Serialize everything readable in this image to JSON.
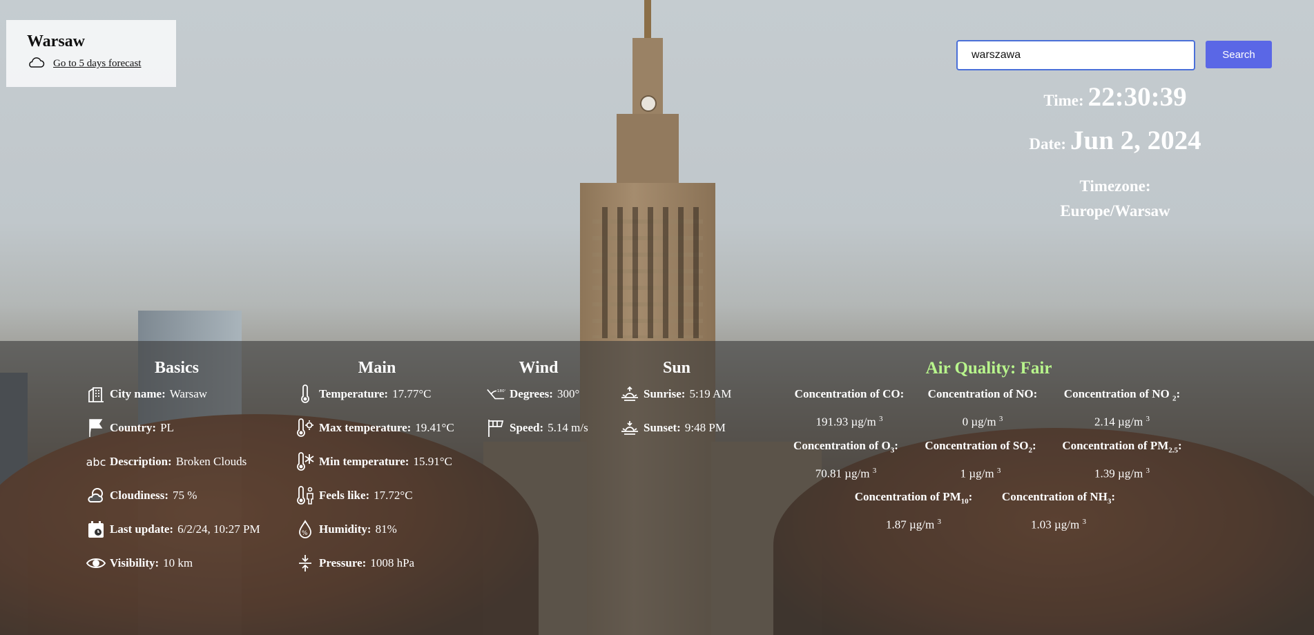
{
  "city_card": {
    "name": "Warsaw",
    "forecast_link": "Go to 5 days forecast"
  },
  "search": {
    "value": "warszawa",
    "button": "Search"
  },
  "clock": {
    "time_label": "Time:",
    "time": "22:30:39",
    "date_label": "Date:",
    "date": "Jun 2, 2024",
    "tz_label": "Timezone:",
    "tz": "Europe/Warsaw"
  },
  "basics": {
    "title": "Basics",
    "items": [
      {
        "icon": "city-icon",
        "label": "City name:",
        "value": "Warsaw"
      },
      {
        "icon": "flag-icon",
        "label": "Country:",
        "value": "PL"
      },
      {
        "icon": "text-abc-icon",
        "label": "Description:",
        "value": "Broken Clouds"
      },
      {
        "icon": "cloudiness-icon",
        "label": "Cloudiness:",
        "value": "75 %"
      },
      {
        "icon": "calendar-clock-icon",
        "label": "Last update:",
        "value": "6/2/24, 10:27 PM"
      },
      {
        "icon": "eye-icon",
        "label": "Visibility:",
        "value": "10 km"
      }
    ]
  },
  "main": {
    "title": "Main",
    "items": [
      {
        "icon": "thermometer-icon",
        "label": "Temperature:",
        "value": "17.77°C"
      },
      {
        "icon": "thermometer-hot-icon",
        "label": "Max temperature:",
        "value": "19.41°C"
      },
      {
        "icon": "thermometer-cold-icon",
        "label": "Min temperature:",
        "value": "15.91°C"
      },
      {
        "icon": "feels-like-icon",
        "label": "Feels like:",
        "value": "17.72°C"
      },
      {
        "icon": "humidity-icon",
        "label": "Humidity:",
        "value": "81%"
      },
      {
        "icon": "pressure-icon",
        "label": "Pressure:",
        "value": "1008 hPa"
      }
    ]
  },
  "wind": {
    "title": "Wind",
    "items": [
      {
        "icon": "wind-degree-icon",
        "label": "Degrees:",
        "value": "300°"
      },
      {
        "icon": "windsock-icon",
        "label": "Speed:",
        "value": "5.14 m/s"
      }
    ]
  },
  "sun": {
    "title": "Sun",
    "items": [
      {
        "icon": "sunrise-icon",
        "label": "Sunrise:",
        "value": "5:19 AM"
      },
      {
        "icon": "sunset-icon",
        "label": "Sunset:",
        "value": "9:48 PM"
      }
    ]
  },
  "air_quality": {
    "title": "Air Quality: Fair",
    "color": "#b8f58c",
    "unit": "µg/m",
    "unit_exp": "3",
    "prefix": "Concentration of ",
    "items": [
      {
        "main": "CO",
        "sub": "",
        "value": "191.93"
      },
      {
        "main": "NO",
        "sub": "",
        "value": "0"
      },
      {
        "main": "NO",
        "sub": "2",
        "value": "2.14"
      },
      {
        "main": "O",
        "sub": "3",
        "value": "70.81"
      },
      {
        "main": "SO",
        "sub": "2",
        "value": "1"
      },
      {
        "main": "PM",
        "sub": "2.5",
        "value": "1.39"
      },
      {
        "main": "PM",
        "sub": "10",
        "value": "1.87"
      },
      {
        "main": "NH",
        "sub": "3",
        "value": "1.03"
      }
    ]
  }
}
